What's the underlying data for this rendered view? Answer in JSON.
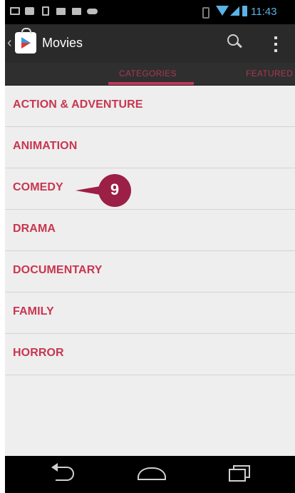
{
  "status_bar": {
    "time": "11:43",
    "notification_icons": [
      "mail-icon",
      "chat-icon",
      "phone-icon",
      "bag-icon",
      "bag-icon",
      "game-controller-icon"
    ],
    "system_icons": [
      "bluetooth-icon",
      "wifi-icon",
      "signal-icon",
      "battery-icon"
    ]
  },
  "action_bar": {
    "app_icon": "play-store-icon",
    "title": "Movies",
    "actions": [
      "search-icon",
      "overflow-menu-icon"
    ]
  },
  "tabs": [
    {
      "label": "CATEGORIES",
      "selected": true
    },
    {
      "label": "FEATURED",
      "selected": false
    }
  ],
  "categories": [
    "ACTION & ADVENTURE",
    "ANIMATION",
    "COMEDY",
    "DRAMA",
    "DOCUMENTARY",
    "FAMILY",
    "HORROR"
  ],
  "callout": {
    "glyph": "9",
    "target": "COMEDY",
    "color": "#9c1f45"
  },
  "colors": {
    "accent": "#c8364f",
    "tab_text": "#a63a52",
    "action_bar": "#2a2a2a",
    "list_background": "#eeeeee",
    "status_icons": "#5ab3e6"
  },
  "nav_bar": {
    "buttons": [
      "back-icon",
      "home-icon",
      "recent-apps-icon"
    ]
  }
}
